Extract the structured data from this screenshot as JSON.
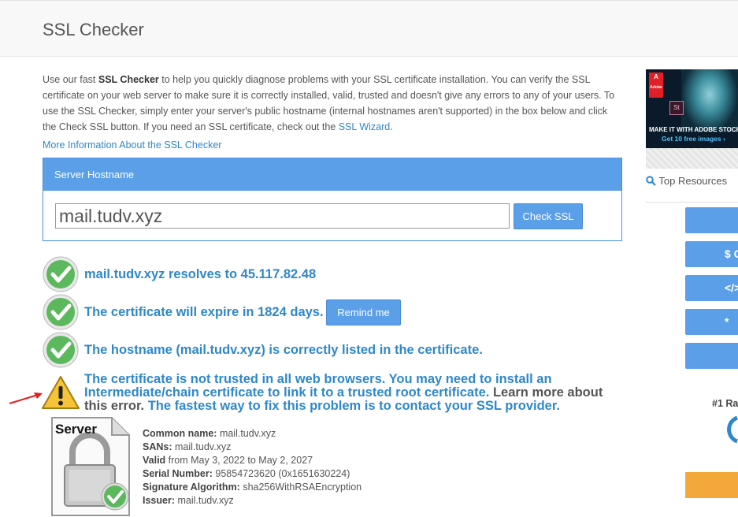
{
  "header": {
    "title": "SSL Checker"
  },
  "intro": {
    "part1": "Use our fast ",
    "bold": "SSL Checker",
    "part2": " to help you quickly diagnose problems with your SSL certificate installation. You can verify the SSL certificate on your web server to make sure it is correctly installed, valid, trusted and doesn't give any errors to any of your users. To use the SSL Checker, simply enter your server's public hostname (internal hostnames aren't supported) in the box below and click the Check SSL button. If you need an SSL certificate, check out the ",
    "wizard_link": "SSL Wizard",
    "part3": "."
  },
  "more_info_link": "More Information About the SSL Checker",
  "form": {
    "panel_title": "Server Hostname",
    "hostname_value": "mail.tudv.xyz",
    "check_button": "Check SSL"
  },
  "results": {
    "resolves": "mail.tudv.xyz resolves to 45.117.82.48",
    "expire": "The certificate will expire in 1824 days.",
    "remind_button": "Remind me",
    "hostname_listed": "The hostname (mail.tudv.xyz) is correctly listed in the certificate.",
    "warning_part1": "The certificate is not trusted in all web browsers. You may need to install an Intermediate/chain certificate to link it to a trusted root certificate.",
    "warning_learn": " Learn more about this error.",
    "warning_part2": " The fastest way to fix this problem is to contact your SSL provider."
  },
  "certificate": {
    "icon_label": "Server",
    "common_name_label": "Common name:",
    "common_name": "mail.tudv.xyz",
    "sans_label": "SANs:",
    "sans": "mail.tudv.xyz",
    "valid_label": "Valid",
    "valid": "from May 3, 2022 to May 2, 2027",
    "serial_label": "Serial Number:",
    "serial": "95854723620 (0x1651630224)",
    "sigalg_label": "Signature Algorithm:",
    "sigalg": "sha256WithRSAEncryption",
    "issuer_label": "Issuer:",
    "issuer": "mail.tudv.xyz"
  },
  "sidebar": {
    "ad": {
      "brand": "Adobe",
      "badge": "St",
      "line1": "MAKE IT WITH ADOBE STOCK",
      "line2": "Get 10 free images ›"
    },
    "top_resources": "Top Resources",
    "buttons": [
      "",
      "$ C",
      "</> C",
      "*",
      ""
    ],
    "rank": "#1 Ra"
  },
  "colors": {
    "accent": "#5b9fe8",
    "link": "#2e88c9",
    "orange": "#f5a83a"
  },
  "icons": [
    "checkmark-icon",
    "warning-icon",
    "arrow-icon",
    "search-icon",
    "certificate-icon"
  ]
}
